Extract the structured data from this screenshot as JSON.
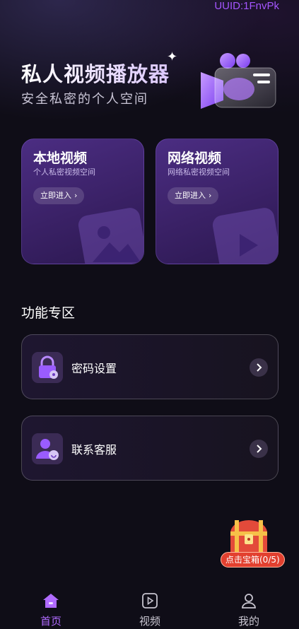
{
  "header": {
    "uuid": "UUID:1FnvPk",
    "title": "私人视频播放器",
    "subtitle": "安全私密的个人空间"
  },
  "cards": [
    {
      "title": "本地视频",
      "subtitle": "个人私密视频空间",
      "button": "立即进入"
    },
    {
      "title": "网络视频",
      "subtitle": "网络私密视频空间",
      "button": "立即进入"
    }
  ],
  "features": {
    "section_title": "功能专区",
    "items": [
      {
        "label": "密码设置",
        "icon": "lock-icon"
      },
      {
        "label": "联系客服",
        "icon": "support-agent-icon"
      }
    ]
  },
  "treasure": {
    "label": "点击宝箱(0/5)"
  },
  "tabbar": {
    "tabs": [
      {
        "label": "首页",
        "icon": "home-icon",
        "active": true
      },
      {
        "label": "视频",
        "icon": "play-icon",
        "active": false
      },
      {
        "label": "我的",
        "icon": "user-icon",
        "active": false
      }
    ]
  },
  "colors": {
    "accent": "#a455ff",
    "background": "#0f0d17",
    "card": "#3a2166"
  }
}
